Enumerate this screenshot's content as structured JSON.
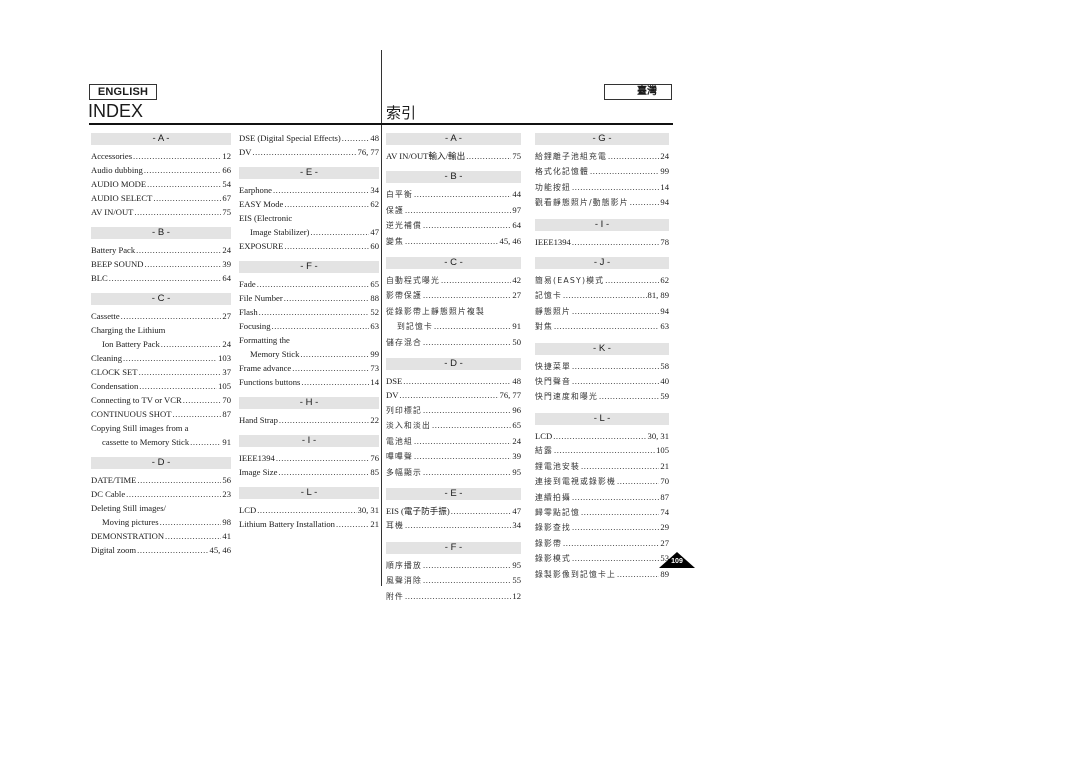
{
  "header": {
    "lang_left": "ENGLISH",
    "lang_right": "臺灣",
    "title_left": "INDEX",
    "title_right": "索引"
  },
  "columns": [
    {
      "sections": [
        {
          "letter": "- A -",
          "entries": [
            {
              "name": "Accessories",
              "page": "12"
            },
            {
              "name": "Audio dubbing",
              "page": "66"
            },
            {
              "name": "AUDIO MODE",
              "page": "54"
            },
            {
              "name": "AUDIO SELECT",
              "page": "67"
            },
            {
              "name": "AV IN/OUT",
              "page": "75"
            }
          ]
        },
        {
          "letter": "- B -",
          "entries": [
            {
              "name": "Battery Pack",
              "page": "24"
            },
            {
              "name": "BEEP SOUND",
              "page": "39"
            },
            {
              "name": "BLC",
              "page": "64"
            }
          ]
        },
        {
          "letter": "- C -",
          "entries": [
            {
              "name": "Cassette",
              "page": "27"
            },
            {
              "name": "Charging the Lithium",
              "cont": "Ion Battery Pack",
              "page": "24"
            },
            {
              "name": "Cleaning",
              "page": "103"
            },
            {
              "name": "CLOCK SET",
              "page": "37"
            },
            {
              "name": "Condensation",
              "page": "105"
            },
            {
              "name": "Connecting to TV or VCR",
              "page": "70"
            },
            {
              "name": "CONTINUOUS SHOT",
              "page": "87"
            },
            {
              "name": "Copying Still images from a",
              "cont": "cassette to Memory Stick",
              "page": "91"
            }
          ]
        },
        {
          "letter": "- D -",
          "entries": [
            {
              "name": "DATE/TIME",
              "page": "56"
            },
            {
              "name": "DC Cable",
              "page": "23"
            },
            {
              "name": "Deleting Still images/",
              "cont": "Moving pictures",
              "page": "98"
            },
            {
              "name": "DEMONSTRATION",
              "page": "41"
            },
            {
              "name": "Digital zoom",
              "page": "45, 46"
            }
          ]
        }
      ]
    },
    {
      "sections": [
        {
          "letter": "",
          "entries": [
            {
              "name": "DSE (Digital Special Effects)",
              "page": "48"
            },
            {
              "name": "DV",
              "page": "76, 77"
            }
          ]
        },
        {
          "letter": "- E -",
          "entries": [
            {
              "name": "Earphone",
              "page": "34"
            },
            {
              "name": "EASY Mode",
              "page": "62"
            },
            {
              "name": "EIS (Electronic",
              "cont": "Image Stabilizer)",
              "page": "47"
            },
            {
              "name": "EXPOSURE",
              "page": "60"
            }
          ]
        },
        {
          "letter": "- F -",
          "entries": [
            {
              "name": "Fade",
              "page": "65"
            },
            {
              "name": "File Number",
              "page": "88"
            },
            {
              "name": "Flash",
              "page": "52"
            },
            {
              "name": "Focusing",
              "page": "63"
            },
            {
              "name": "Formatting the",
              "cont": "Memory Stick",
              "page": "99"
            },
            {
              "name": "Frame advance",
              "page": "73"
            },
            {
              "name": "Functions buttons",
              "page": "14"
            }
          ]
        },
        {
          "letter": "- H -",
          "entries": [
            {
              "name": "Hand Strap",
              "page": "22"
            }
          ]
        },
        {
          "letter": "- I -",
          "entries": [
            {
              "name": "IEEE1394",
              "page": "76"
            },
            {
              "name": "Image Size",
              "page": "85"
            }
          ]
        },
        {
          "letter": "- L -",
          "entries": [
            {
              "name": "LCD",
              "page": "30, 31"
            },
            {
              "name": "Lithium Battery Installation",
              "page": "21"
            }
          ]
        }
      ]
    },
    {
      "sections": [
        {
          "letter": "- A -",
          "entries": [
            {
              "name": "AV IN/OUT輸入/輸出",
              "page": "75",
              "latin": true
            }
          ]
        },
        {
          "letter": "- B -",
          "entries": [
            {
              "name": "白平衡",
              "page": "44"
            },
            {
              "name": "保護",
              "page": "97"
            },
            {
              "name": "逆光補償",
              "page": "64"
            },
            {
              "name": "變焦",
              "page": "45, 46"
            }
          ]
        },
        {
          "letter": "- C -",
          "entries": [
            {
              "name": "自動程式曝光",
              "page": "42"
            },
            {
              "name": "影帶保護",
              "page": "27"
            },
            {
              "name": "從錄影帶上靜態照片複製",
              "cont": "到記憶卡",
              "page": "91"
            },
            {
              "name": "儲存混合",
              "page": "50"
            }
          ]
        },
        {
          "letter": "- D -",
          "entries": [
            {
              "name": "DSE",
              "page": "48",
              "latin": true
            },
            {
              "name": "DV",
              "page": "76, 77",
              "latin": true
            },
            {
              "name": "列印標記",
              "page": "96"
            },
            {
              "name": "淡入和淡出",
              "page": "65"
            },
            {
              "name": "電池組",
              "page": "24"
            },
            {
              "name": "嗶嗶聲",
              "page": "39"
            },
            {
              "name": "多幅顯示",
              "page": "95"
            }
          ]
        },
        {
          "letter": "- E -",
          "entries": [
            {
              "name": "EIS (電子防手振)",
              "page": "47",
              "latin": true
            },
            {
              "name": "耳機",
              "page": "34"
            }
          ]
        },
        {
          "letter": "- F -",
          "entries": [
            {
              "name": "順序播放",
              "page": "95"
            },
            {
              "name": "風聲消除",
              "page": "55"
            },
            {
              "name": "附件",
              "page": "12"
            }
          ]
        }
      ]
    },
    {
      "sections": [
        {
          "letter": "- G -",
          "entries": [
            {
              "name": "給鋰離子池組充電",
              "page": "24"
            },
            {
              "name": "格式化記憶體",
              "page": "99"
            },
            {
              "name": "功能按鈕",
              "page": "14"
            },
            {
              "name": "觀看靜態照片/動態影片",
              "page": "94"
            }
          ]
        },
        {
          "letter": "- I -",
          "entries": [
            {
              "name": "IEEE1394",
              "page": "78",
              "latin": true
            }
          ]
        },
        {
          "letter": "- J -",
          "entries": [
            {
              "name": "簡易(EASY)模式",
              "page": "62"
            },
            {
              "name": "記憶卡",
              "page": "81, 89"
            },
            {
              "name": "靜態照片",
              "page": "94"
            },
            {
              "name": "對焦",
              "page": "63"
            }
          ]
        },
        {
          "letter": "- K -",
          "entries": [
            {
              "name": "快捷菜單",
              "page": "58"
            },
            {
              "name": "快門聲音",
              "page": "40"
            },
            {
              "name": "快門速度和曝光",
              "page": "59"
            }
          ]
        },
        {
          "letter": "- L -",
          "entries": [
            {
              "name": "LCD",
              "page": "30, 31",
              "latin": true
            },
            {
              "name": "結露",
              "page": "105"
            },
            {
              "name": "鋰電池安裝",
              "page": "21"
            },
            {
              "name": "連接到電視或錄影機",
              "page": "70"
            },
            {
              "name": "連續拍攝",
              "page": "87"
            },
            {
              "name": "歸零點記憶",
              "page": "74"
            },
            {
              "name": "錄影查找",
              "page": "29"
            },
            {
              "name": "錄影帶",
              "page": "27"
            },
            {
              "name": "錄影模式",
              "page": "53"
            },
            {
              "name": "錄製影像到記憶卡上",
              "page": "89"
            }
          ]
        }
      ]
    }
  ],
  "page_number": "109"
}
